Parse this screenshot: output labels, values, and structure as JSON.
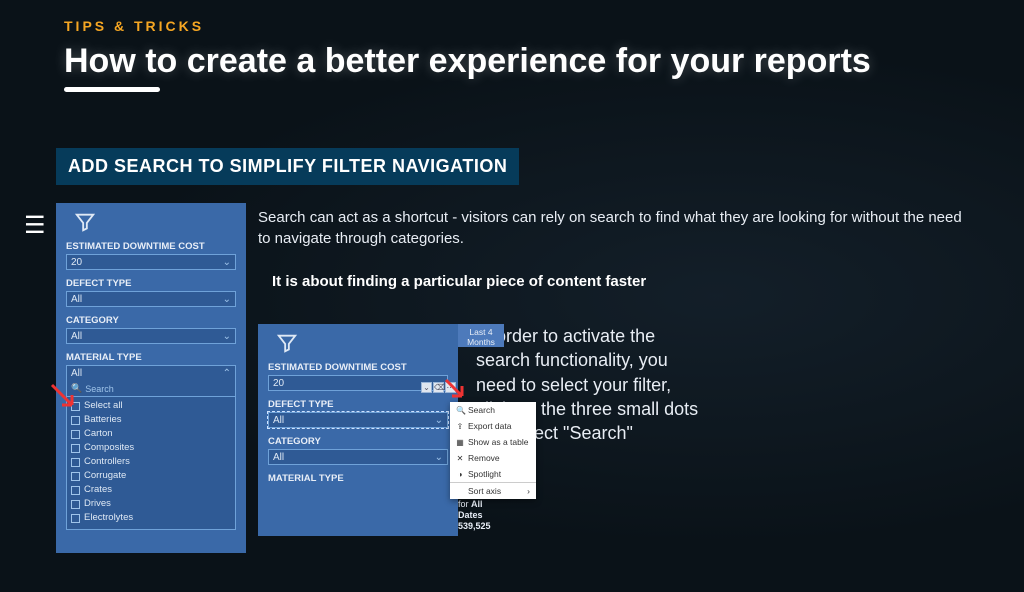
{
  "kicker": "TIPS & TRICKS",
  "title": "How to create a better experience for your reports",
  "subheader": "ADD SEARCH TO SIMPLIFY FILTER NAVIGATION",
  "body": {
    "p1": "Search can act as a shortcut - visitors can rely on search to find what they are looking for without the need to navigate through categories.",
    "p2": "It is about finding a particular piece of content faster",
    "instruction": "In order to activate the search functionality, you need to select your filter, click on the three small dots and select \"Search\""
  },
  "panel1": {
    "fields": {
      "estimated_label": "ESTIMATED DOWNTIME COST",
      "estimated_value": "20",
      "defect_label": "DEFECT TYPE",
      "defect_value": "All",
      "category_label": "CATEGORY",
      "category_value": "All",
      "material_label": "MATERIAL TYPE",
      "material_value": "All",
      "search_placeholder": "Search"
    },
    "material_options": [
      "Select all",
      "Batteries",
      "Carton",
      "Composites",
      "Controllers",
      "Corrugate",
      "Crates",
      "Drives",
      "Electrolytes"
    ]
  },
  "panel2": {
    "last4": "Last 4\nMonths",
    "fields": {
      "estimated_label": "ESTIMATED DOWNTIME COST",
      "estimated_value": "20",
      "defect_label": "DEFECT TYPE",
      "defect_value": "All",
      "category_label": "CATEGORY",
      "category_value": "All",
      "material_label": "MATERIAL TYPE"
    },
    "summary_line1": "for All Dates",
    "summary_line2": "539,525"
  },
  "context_menu": [
    "Search",
    "Export data",
    "Show as a table",
    "Remove",
    "Spotlight",
    "Sort axis"
  ]
}
